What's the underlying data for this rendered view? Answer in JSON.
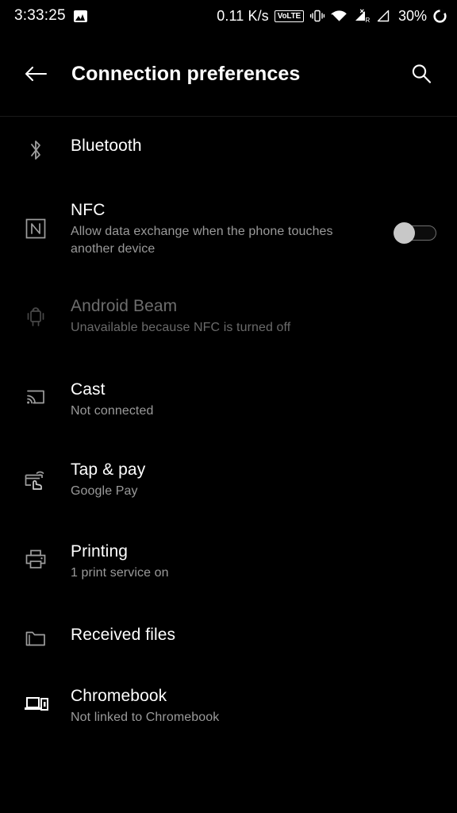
{
  "statusbar": {
    "clock": "3:33:25",
    "image_icon": "image-icon",
    "network_speed": "0.11 K/s",
    "volte_label": "VoLTE",
    "vibrate_icon": "vibrate-icon",
    "wifi_icon": "wifi-icon",
    "signal_one_icon": "signal-no-data-roaming-icon",
    "signal_one_badge_top": "X",
    "signal_one_badge_bottom": "R",
    "signal_two_icon": "signal-icon",
    "battery_percent": "30%",
    "battery_icon": "battery-circle-icon"
  },
  "appbar": {
    "back_icon": "back-arrow-icon",
    "title": "Connection preferences",
    "search_icon": "search-icon"
  },
  "list": {
    "bluetooth": {
      "title": "Bluetooth",
      "subtitle": "",
      "icon": "bluetooth-icon"
    },
    "nfc": {
      "title": "NFC",
      "subtitle": "Allow data exchange when the phone touches another device",
      "icon": "nfc-icon",
      "switch_state": "off"
    },
    "beam": {
      "title": "Android Beam",
      "subtitle": "Unavailable because NFC is turned off",
      "icon": "android-beam-icon",
      "state": "disabled"
    },
    "cast": {
      "title": "Cast",
      "subtitle": "Not connected",
      "icon": "cast-icon"
    },
    "tappay": {
      "title": "Tap & pay",
      "subtitle": "Google Pay",
      "icon": "tap-and-pay-icon"
    },
    "printing": {
      "title": "Printing",
      "subtitle": "1 print service on",
      "icon": "printer-icon"
    },
    "received": {
      "title": "Received files",
      "subtitle": "",
      "icon": "folder-icon"
    },
    "chromebook": {
      "title": "Chromebook",
      "subtitle": "Not linked to Chromebook",
      "icon": "chromebook-icon"
    }
  },
  "colors": {
    "background": "#000000",
    "title_text": "#ffffff",
    "subtitle_text": "#9a9a9a",
    "disabled_text": "#6d6d6d",
    "icon_stroke": "#9e9e9e",
    "switch_knob": "#c8c8c8"
  }
}
